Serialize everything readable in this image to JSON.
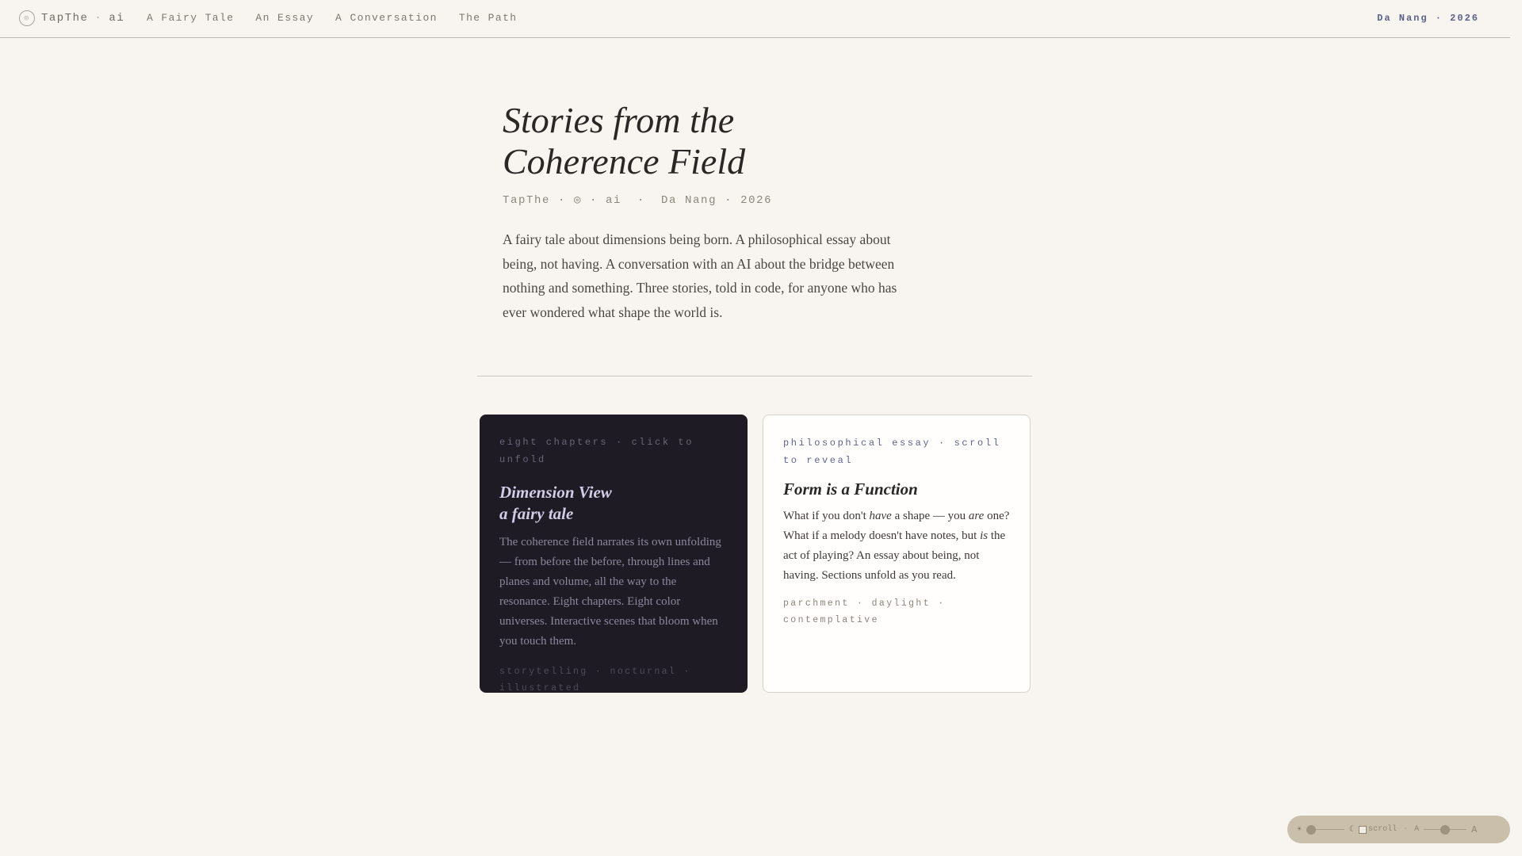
{
  "header": {
    "brand_icon": "◎",
    "brand_name": "TapThe",
    "brand_dot": "·",
    "brand_suffix": "ai",
    "nav": [
      "A Fairy Tale",
      "An Essay",
      "A Conversation",
      "The Path"
    ],
    "location_year": "Da Nang · 2026"
  },
  "hero": {
    "title_line1": "Stories from the",
    "title_line2": "Coherence Field",
    "meta": "TapThe · ◎ · ai  ·  Da Nang · 2026",
    "description": "A fairy tale about dimensions being born. A philosophical essay about being, not having. A conversation with an AI about the bridge between nothing and something. Three stories, told in code, for anyone who has ever wondered what shape the world is."
  },
  "cards": [
    {
      "kicker": "eight chapters · click to unfold",
      "title_line1": "Dimension View",
      "title_line2": "a fairy tale",
      "body": "The coherence field narrates its own unfolding — from before the before, through lines and planes and volume, all the way to the resonance. Eight chapters. Eight color universes. Interactive scenes that bloom when you touch them.",
      "tags": "storytelling · nocturnal · illustrated"
    },
    {
      "kicker": "philosophical essay · scroll to reveal",
      "title": "Form is a Function",
      "body_parts": [
        "What if you don't ",
        "have",
        " a shape — you ",
        "are",
        " one? What if a melody doesn't have notes, but ",
        "is",
        " the act of playing? An essay about being, not having. Sections unfold as you read."
      ],
      "tags": "parchment · daylight · contemplative"
    }
  ],
  "controls": {
    "brightness_icon": "☀",
    "brightness_level": 0,
    "dark_icon": "☾",
    "scroll_label": "scroll",
    "separator": "·",
    "font_small_label": "A",
    "font_large_label": "A",
    "font_level": 0.5
  },
  "colors": {
    "background": "#f8f5f0",
    "accent": "#5b6289",
    "dark_card": "#1e1b24",
    "pill": "#c9bfab"
  }
}
